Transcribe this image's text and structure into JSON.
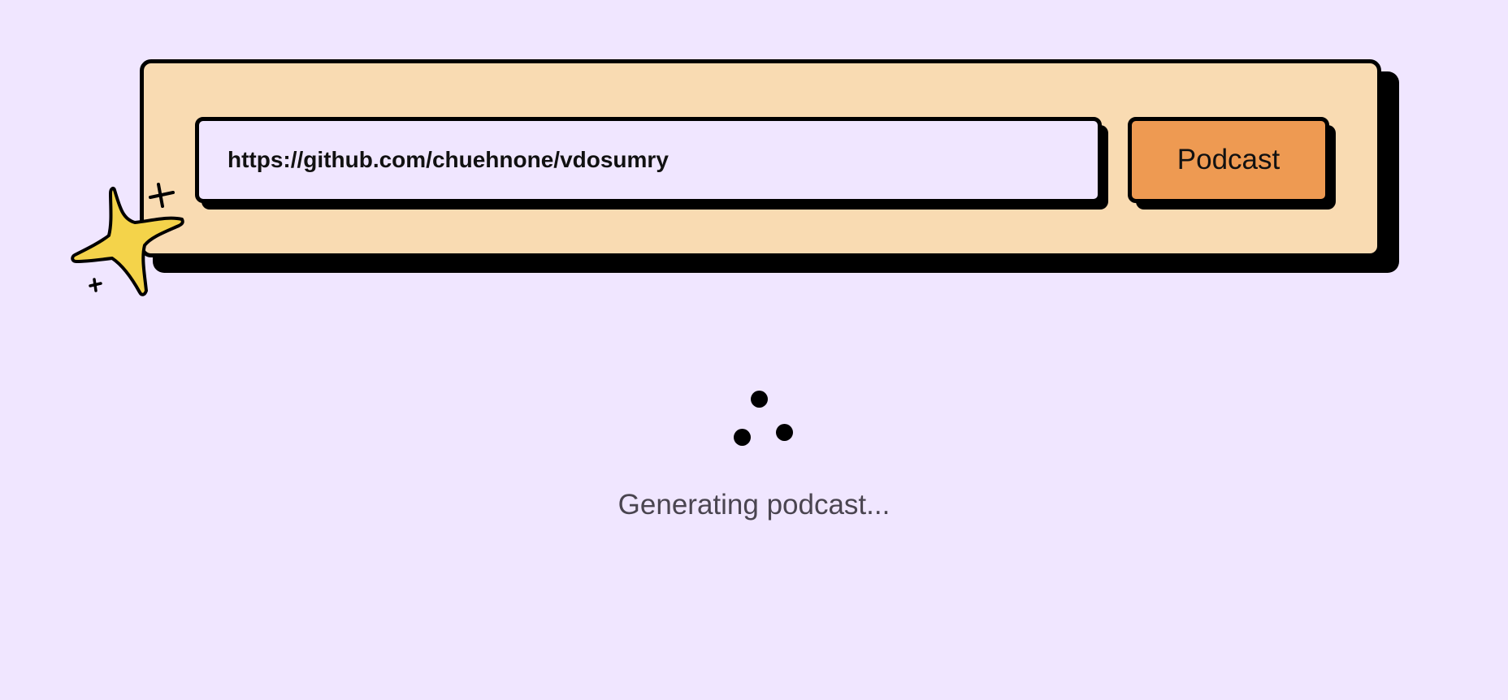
{
  "form": {
    "url_value": "https://github.com/chuehnone/vdosumry",
    "submit_label": "Podcast"
  },
  "status": {
    "text": "Generating podcast..."
  },
  "colors": {
    "background": "#f0e6ff",
    "card": "#f9dbb2",
    "button": "#ee9a52",
    "sparkle": "#f4d34a"
  },
  "icons": {
    "sparkle": "sparkle-icon",
    "loader": "loading-spinner-icon"
  }
}
